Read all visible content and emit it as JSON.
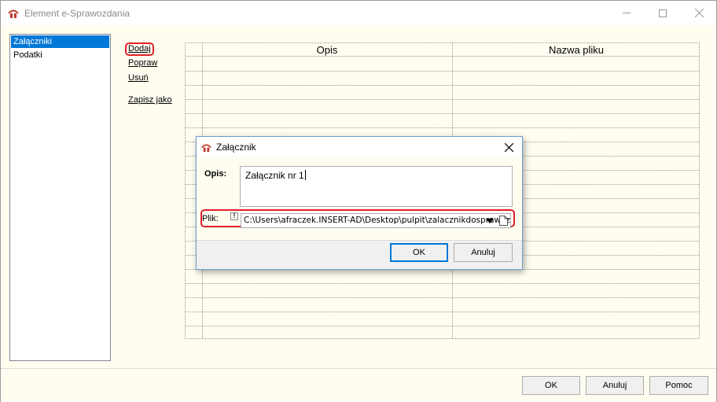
{
  "window": {
    "title": "Element e-Sprawozdania",
    "controls": [
      "minimize-icon",
      "maximize-icon",
      "close-icon"
    ]
  },
  "sidebar": {
    "items": [
      {
        "label": "Załączniki",
        "selected": true
      },
      {
        "label": "Podatki",
        "selected": false
      }
    ]
  },
  "actions": {
    "add": "Dodaj",
    "edit": "Popraw",
    "delete": "Usuń",
    "save_as": "Zapisz jako"
  },
  "table": {
    "columns": [
      "Opis",
      "Nazwa pliku"
    ],
    "rows": []
  },
  "footer": {
    "ok": "OK",
    "cancel": "Anuluj",
    "help": "Pomoc"
  },
  "dialog": {
    "title": "Załącznik",
    "description_label": "Opis:",
    "description_value": "Załącznik nr 1",
    "file_label": "Plik:",
    "required_marker": "!",
    "file_value": "C:\\Users\\afraczek.INSERT-AD\\Desktop\\pulpit\\zalacznikdosprawozdania.pdf",
    "ok": "OK",
    "cancel": "Anuluj"
  },
  "colors": {
    "accent": "#0078d7",
    "highlight": "#e0202c",
    "panel_bg": "#fffdf0"
  }
}
